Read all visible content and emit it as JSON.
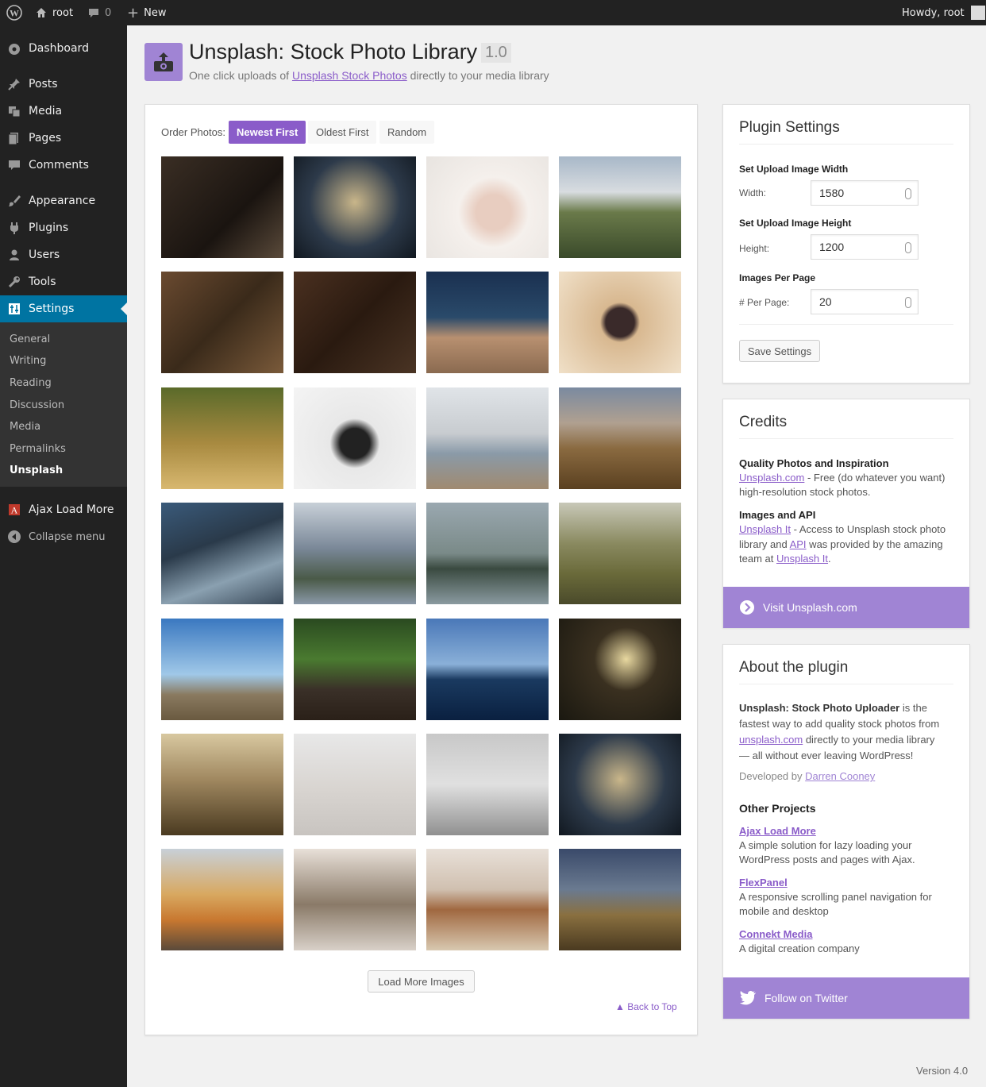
{
  "adminbar": {
    "site_name": "root",
    "comments_count": "0",
    "new_label": "New",
    "howdy": "Howdy, root"
  },
  "sidebar": {
    "items": [
      {
        "label": "Dashboard",
        "icon": "dashboard-icon"
      },
      {
        "label": "Posts",
        "icon": "pin-icon"
      },
      {
        "label": "Media",
        "icon": "media-icon"
      },
      {
        "label": "Pages",
        "icon": "pages-icon"
      },
      {
        "label": "Comments",
        "icon": "comment-icon"
      },
      {
        "label": "Appearance",
        "icon": "brush-icon"
      },
      {
        "label": "Plugins",
        "icon": "plug-icon"
      },
      {
        "label": "Users",
        "icon": "user-icon"
      },
      {
        "label": "Tools",
        "icon": "wrench-icon"
      },
      {
        "label": "Settings",
        "icon": "settings-icon"
      },
      {
        "label": "Ajax Load More",
        "icon": "ajax-load-more-icon"
      },
      {
        "label": "Collapse menu",
        "icon": "collapse-icon"
      }
    ],
    "submenu": [
      "General",
      "Writing",
      "Reading",
      "Discussion",
      "Media",
      "Permalinks",
      "Unsplash"
    ]
  },
  "header": {
    "title": "Unsplash: Stock Photo Library",
    "version": "1.0",
    "subtitle_prefix": "One click uploads of ",
    "subtitle_link": "Unsplash Stock Photos",
    "subtitle_suffix": " directly to your media library"
  },
  "gallery": {
    "order_label": "Order Photos:",
    "order_options": [
      "Newest First",
      "Oldest First",
      "Random"
    ],
    "selected_order": "Newest First",
    "load_more": "Load More Images",
    "back_to_top": "Back to Top"
  },
  "settings": {
    "title": "Plugin Settings",
    "width_heading": "Set Upload Image Width",
    "width_label": "Width:",
    "width_value": "1580",
    "height_heading": "Set Upload Image Height",
    "height_label": "Height:",
    "height_value": "1200",
    "per_page_heading": "Images Per Page",
    "per_page_label": "# Per Page:",
    "per_page_value": "20",
    "save": "Save Settings"
  },
  "credits": {
    "title": "Credits",
    "q_heading": "Quality Photos and Inspiration",
    "q_link": "Unsplash.com",
    "q_text1": " - Free (do whatever you want)",
    "q_text2": "high-resolution stock photos.",
    "api_heading": "Images and API",
    "api_link1": "Unsplash It",
    "api_text1": " - Access to Unsplash stock photo",
    "api_text2a": "library and ",
    "api_link2": "API",
    "api_text2b": " was provided by the amazing",
    "api_text3a": "team at ",
    "api_link3": "Unsplash It",
    "api_text3b": ".",
    "cta": "Visit Unsplash.com"
  },
  "about": {
    "title": "About the plugin",
    "line1_bold": "Unsplash: Stock Photo Uploader",
    "line1_rest": " is the",
    "line2": "fastest way to add quality stock photos from",
    "line3_link": "unsplash.com",
    "line3_rest": " directly to your media library",
    "line4": "— all without ever leaving WordPress!",
    "dev_prefix": "Developed by ",
    "dev_link": "Darren Cooney",
    "other_heading": "Other Projects",
    "projects": [
      {
        "name": "Ajax Load More",
        "desc1": "A simple solution for lazy loading your",
        "desc2": "WordPress posts and pages with Ajax."
      },
      {
        "name": "FlexPanel",
        "desc1": "A responsive scrolling panel navigation for",
        "desc2": "mobile and desktop"
      },
      {
        "name": "Connekt Media",
        "desc1": "A digital creation company",
        "desc2": ""
      }
    ],
    "cta": "Follow on Twitter"
  },
  "footer": {
    "version": "Version 4.0"
  },
  "colors": {
    "accent": "#8a5cc9",
    "accent_light": "#a084d4",
    "wp_blue": "#0074a2",
    "sidebar_bg": "#222"
  }
}
